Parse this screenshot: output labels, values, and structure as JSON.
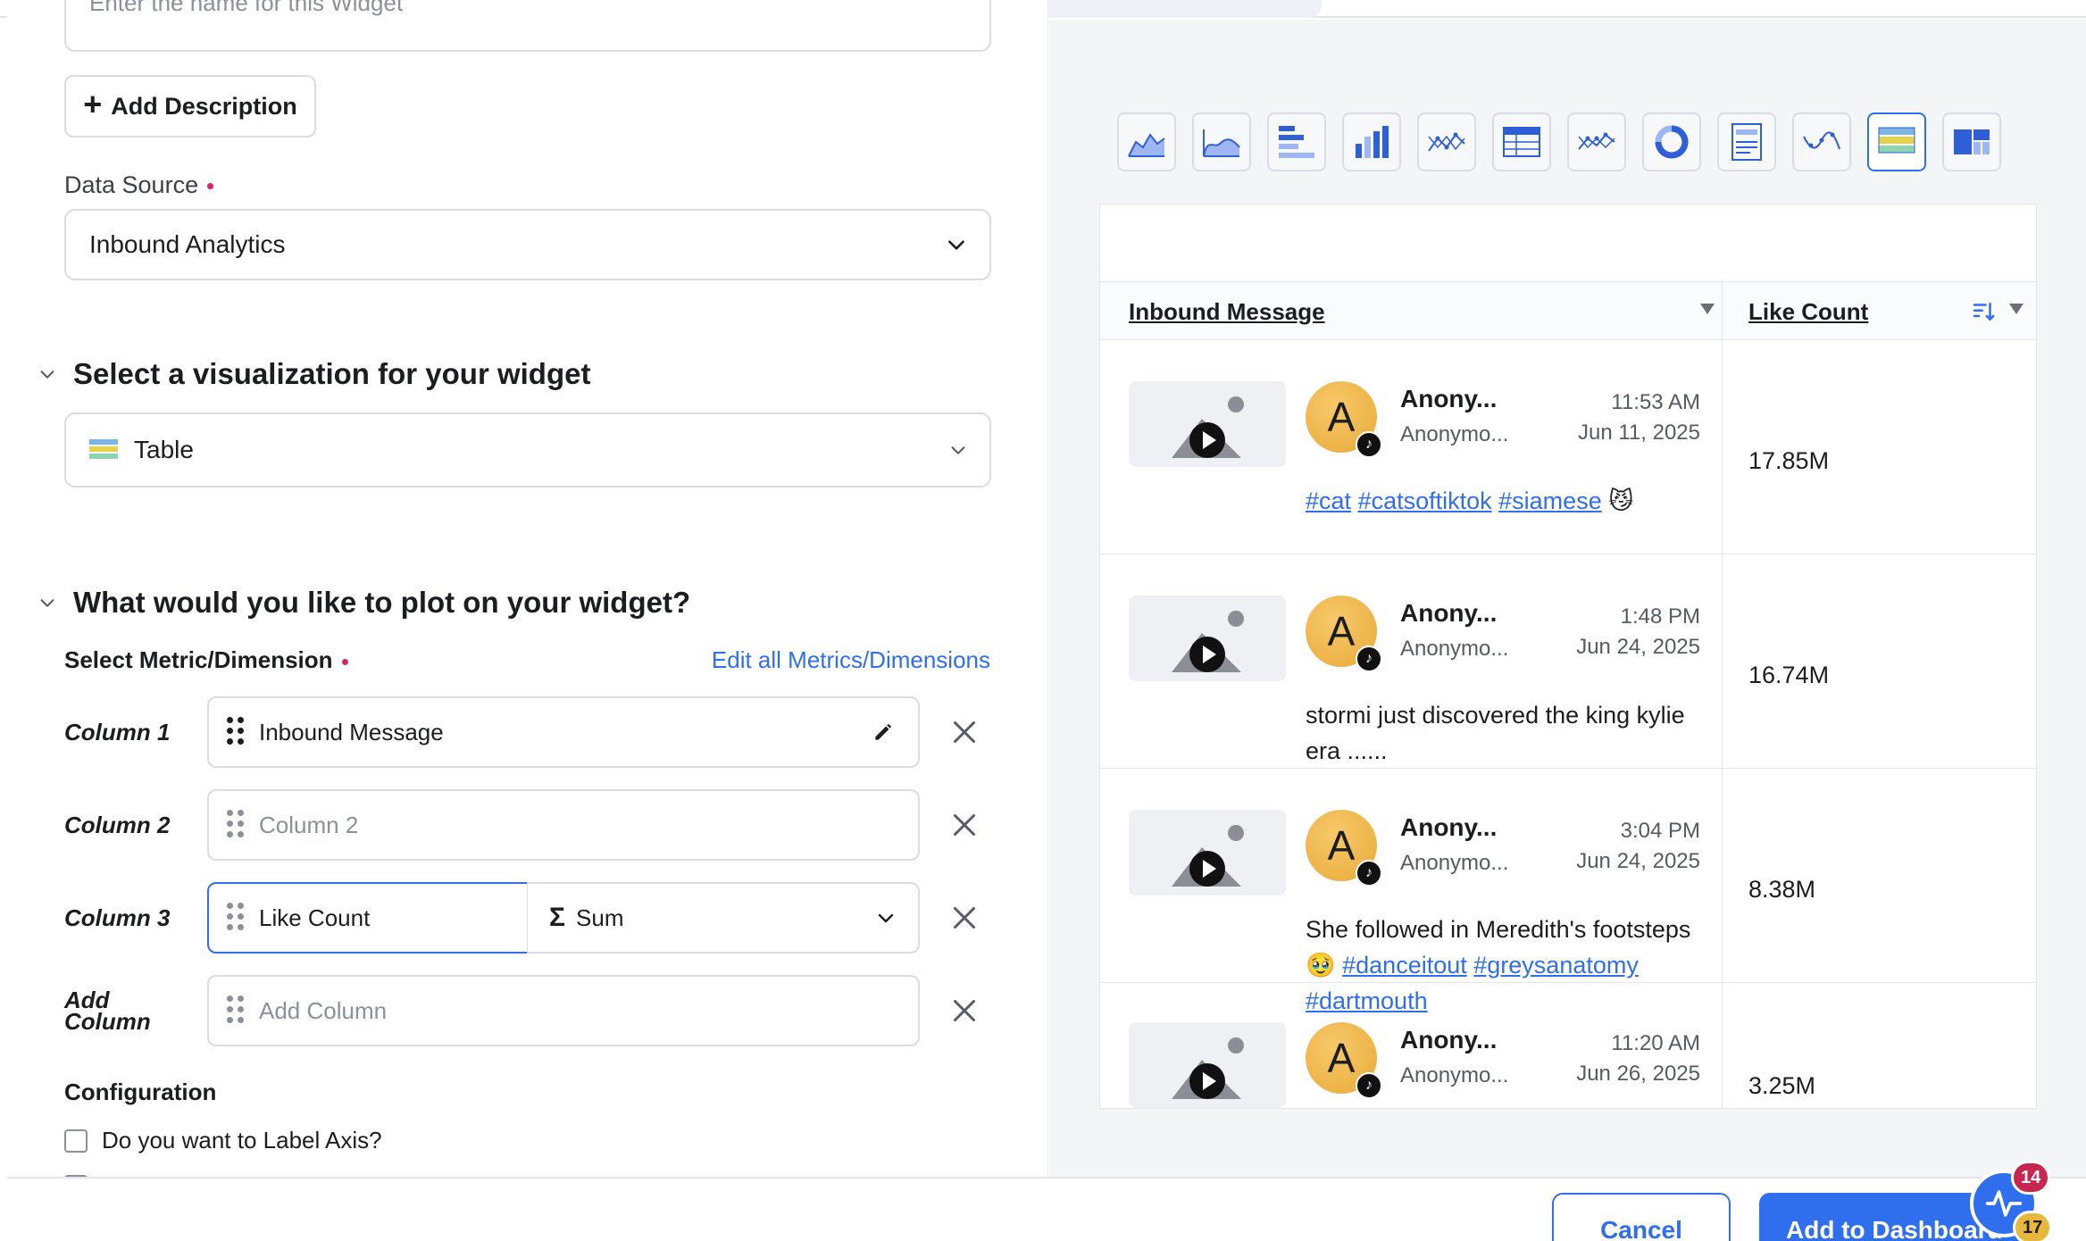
{
  "form": {
    "name_placeholder": "Enter the name for this Widget",
    "add_description": "Add Description",
    "data_source_label": "Data Source",
    "data_source_value": "Inbound Analytics",
    "viz_section_title": "Select a visualization for your widget",
    "viz_value": "Table",
    "plot_section_title": "What would you like to plot on your widget?",
    "metric_label": "Select Metric/Dimension",
    "edit_link": "Edit all Metrics/Dimensions",
    "columns": [
      {
        "label": "Column 1",
        "value": "Inbound Message"
      },
      {
        "label": "Column 2",
        "placeholder": "Column 2"
      },
      {
        "label": "Column 3",
        "value": "Like Count",
        "aggregation": "Sum"
      },
      {
        "label_line1": "Add",
        "label_line2": "Column",
        "placeholder": "Add Column"
      }
    ],
    "config_title": "Configuration",
    "label_axis_question": "Do you want to Label Axis?"
  },
  "preview": {
    "headers": [
      "Inbound Message",
      "Like Count"
    ],
    "rows": [
      {
        "author": "Anony...",
        "handle": "Anonymo...",
        "time": "11:53 AM",
        "date": "Jun 11, 2025",
        "message_parts": [
          {
            "t": "#cat",
            "link": true
          },
          {
            "t": " "
          },
          {
            "t": "#catsoftiktok",
            "link": true
          },
          {
            "t": " "
          },
          {
            "t": "#siamese",
            "link": true
          },
          {
            "t": " 😼"
          }
        ],
        "likes": "17.85M"
      },
      {
        "author": "Anony...",
        "handle": "Anonymo...",
        "time": "1:48 PM",
        "date": "Jun 24, 2025",
        "message_parts": [
          {
            "t": "stormi just discovered the king kylie era ......"
          }
        ],
        "likes": "16.74M"
      },
      {
        "author": "Anony...",
        "handle": "Anonymo...",
        "time": "3:04 PM",
        "date": "Jun 24, 2025",
        "message_parts": [
          {
            "t": "She followed in Meredith's footsteps🥹 "
          },
          {
            "t": "#danceitout",
            "link": true
          },
          {
            "t": " "
          },
          {
            "t": "#greysanatomy",
            "link": true
          },
          {
            "t": " "
          },
          {
            "t": "#dartmouth",
            "link": true
          }
        ],
        "likes": "8.38M"
      },
      {
        "author": "Anony...",
        "handle": "Anonymo...",
        "time": "11:20 AM",
        "date": "Jun 26, 2025",
        "message_parts": [],
        "likes": "3.25M"
      }
    ],
    "avatar_letter": "A"
  },
  "footer": {
    "cancel": "Cancel",
    "add": "Add to Dashboard",
    "badge_red": "14",
    "badge_yellow": "17"
  },
  "viz_types": [
    "area-chart-icon",
    "spline-area-icon",
    "horizontal-bar-icon",
    "column-chart-icon",
    "scatter-icon",
    "pivot-table-icon",
    "line-points-icon",
    "donut-icon",
    "text-card-icon",
    "spline-icon",
    "table-icon",
    "treemap-icon"
  ],
  "colors": {
    "accent": "#2f6fed",
    "required": "#d6246c",
    "badge_red": "#c7264f",
    "badge_yellow": "#e8b83d"
  }
}
